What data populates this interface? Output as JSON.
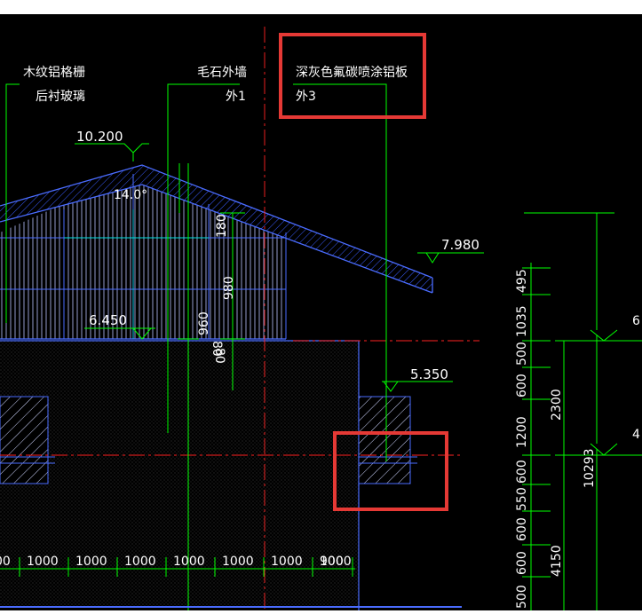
{
  "colors": {
    "background": "#000000",
    "outline": "#4a6cff",
    "leader": "#00ff00",
    "centerline": "#ff2222",
    "roof_hatch": "#3a5cff",
    "highlight": "#e53935",
    "text": "#ffffff"
  },
  "annotations": {
    "grille": {
      "line1": "木纹铝格栅",
      "line2": "后衬玻璃"
    },
    "stone": {
      "line1": "毛石外墙",
      "line2": "外1"
    },
    "panel": {
      "line1": "深灰色氟碳喷涂铝板",
      "line2": "外3"
    }
  },
  "levels": {
    "ridge": "10.200",
    "eave_right": "7.980",
    "eave_left": "6.450",
    "sill": "5.350"
  },
  "roof_angle": "14.0°",
  "inner_dims": {
    "a": "180",
    "b": "80",
    "c": "980",
    "d": "960",
    "e": "80"
  },
  "bottom_dims": [
    "00",
    "1000",
    "1000",
    "1000",
    "1000",
    "1000",
    "1000",
    "1000",
    "900"
  ],
  "right_dims_col1": [
    "495",
    "1035",
    "500",
    "600",
    "1200",
    "600",
    "550",
    "600",
    "600",
    "500"
  ],
  "right_dims_col2": [
    "2300",
    "4150"
  ],
  "right_dims_col3": [
    "10293"
  ],
  "right_edge_labels": [
    "6",
    "4"
  ]
}
